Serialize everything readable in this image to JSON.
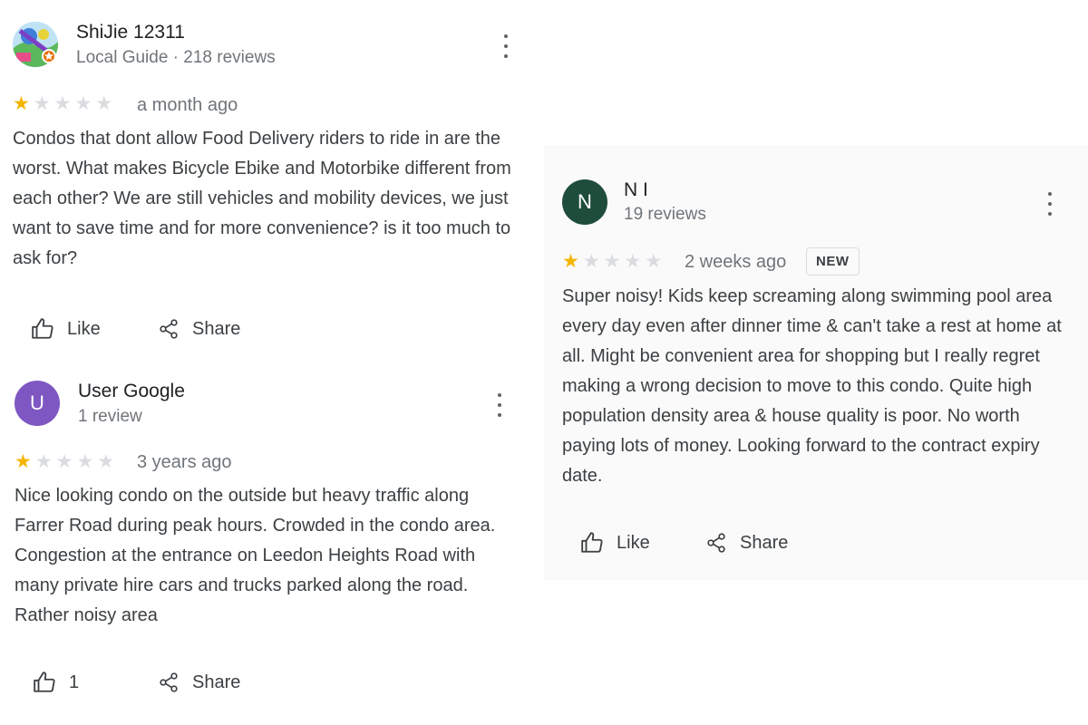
{
  "reviews": [
    {
      "author": "ShiJie 12311",
      "author_meta": "Local Guide · 218 reviews",
      "rating": 1,
      "max_rating": 5,
      "date": "a month ago",
      "text": "Condos that dont allow Food Delivery riders to ride in are the worst. What makes Bicycle Ebike and Motorbike different from each other? We are still vehicles and mobility devices, we just want to save time and for more convenience? is it too much to ask for?",
      "like_label": "Like",
      "share_label": "Share"
    },
    {
      "author": "User Google",
      "author_meta": "1 review",
      "avatar_initial": "U",
      "avatar_color": "#7e57c2",
      "rating": 1,
      "max_rating": 5,
      "date": "3 years ago",
      "text": "Nice looking condo on the outside but heavy traffic along Farrer Road during peak hours. Crowded in the condo area. Congestion at the entrance on Leedon Heights Road with many private hire cars and trucks parked along the road. Rather noisy area",
      "like_label": "1",
      "share_label": "Share"
    },
    {
      "author": "N I",
      "author_meta": "19 reviews",
      "avatar_initial": "N",
      "avatar_color": "#1e4d3b",
      "rating": 1,
      "max_rating": 5,
      "date": "2 weeks ago",
      "badge": "NEW",
      "text": "Super noisy! Kids keep screaming along swimming pool area every day even after dinner time & can't take a rest at home at all. Might be convenient area for shopping but I really regret making a wrong decision to move to this condo. Quite high population density area & house quality is poor. No worth paying lots of money. Looking forward to the contract expiry date.",
      "like_label": "Like",
      "share_label": "Share"
    }
  ],
  "icons": {
    "menu": "more-vert-icon",
    "like": "thumb-up-icon",
    "share": "share-icon",
    "star": "star-icon",
    "guide_badge": "local-guide-badge-icon"
  },
  "colors": {
    "star_filled": "#f4b400",
    "star_empty": "#dadce0"
  }
}
